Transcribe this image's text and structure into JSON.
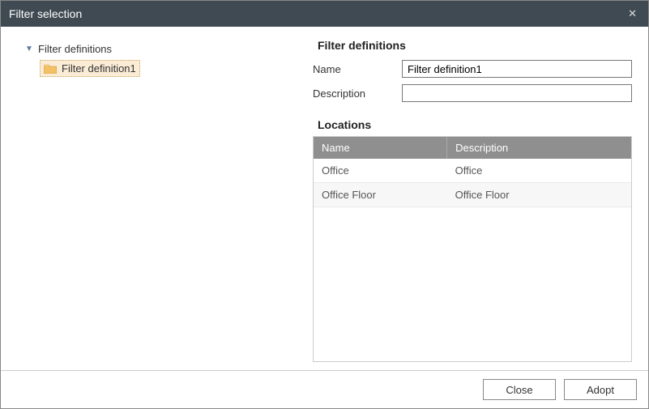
{
  "title": "Filter selection",
  "tree": {
    "root_label": "Filter definitions",
    "child_label": "Filter definition1"
  },
  "details": {
    "heading": "Filter definitions",
    "name_label": "Name",
    "name_value": "Filter definition1",
    "description_label": "Description",
    "description_value": ""
  },
  "locations": {
    "heading": "Locations",
    "columns": {
      "name": "Name",
      "description": "Description"
    },
    "rows": [
      {
        "name": "Office",
        "description": "Office"
      },
      {
        "name": "Office Floor",
        "description": "Office Floor"
      }
    ]
  },
  "buttons": {
    "close": "Close",
    "adopt": "Adopt"
  }
}
